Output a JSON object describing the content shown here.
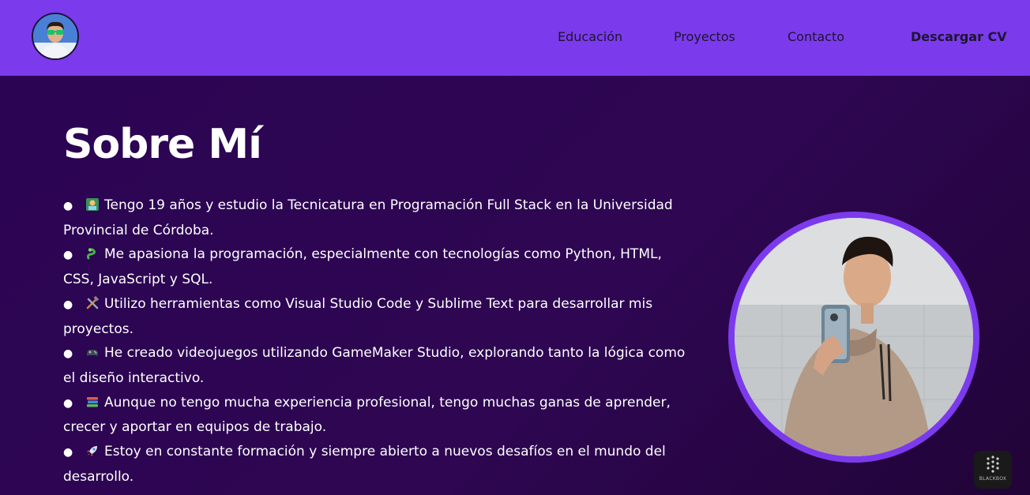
{
  "nav": {
    "links": [
      {
        "label": "Educación"
      },
      {
        "label": "Proyectos"
      },
      {
        "label": "Contacto"
      }
    ],
    "cv_label": "Descargar CV"
  },
  "about": {
    "title": "Sobre Mí",
    "items": [
      {
        "icon": "technologist-emoji",
        "text": "Tengo 19 años y estudio la Tecnicatura en Programación Full Stack en la Universidad Provincial de Córdoba."
      },
      {
        "icon": "snake-emoji",
        "text": "Me apasiona la programación, especialmente con tecnologías como Python, HTML, CSS, JavaScript y SQL."
      },
      {
        "icon": "hammer-wrench-emoji",
        "text": "Utilizo herramientas como Visual Studio Code y Sublime Text para desarrollar mis proyectos."
      },
      {
        "icon": "game-controller-emoji",
        "text": "He creado videojuegos utilizando GameMaker Studio, explorando tanto la lógica como el diseño interactivo."
      },
      {
        "icon": "books-emoji",
        "text": "Aunque no tengo mucha experiencia profesional, tengo muchas ganas de aprender, crecer y aportar en equipos de trabajo."
      },
      {
        "icon": "rocket-emoji",
        "text": "Estoy en constante formación y siempre abierto a nuevos desafíos en el mundo del desarrollo."
      }
    ]
  },
  "widget": {
    "label": "BLACKBOX"
  },
  "colors": {
    "navbar": "#7c3aed",
    "background": "#2b0454",
    "accent_ring": "#7c3aed",
    "nav_text": "#1d1530"
  }
}
